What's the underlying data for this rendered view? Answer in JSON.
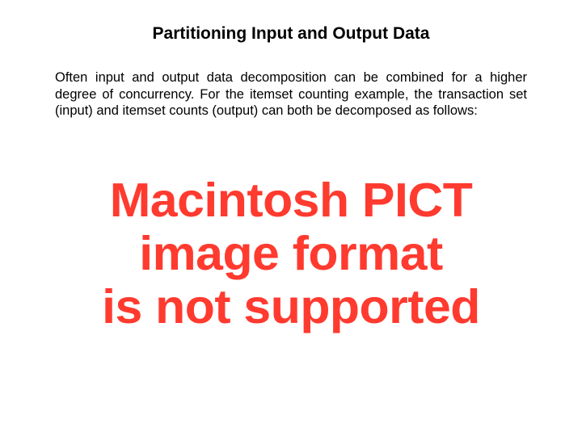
{
  "title": "Partitioning Input and Output Data",
  "paragraph": "Often input and output data decomposition can be combined for a higher degree of concurrency. For the itemset counting example, the transaction set (input) and itemset counts (output) can both be decomposed as follows:",
  "placeholder": {
    "line1": "Macintosh PICT",
    "line2": "image format",
    "line3": "is not supported"
  }
}
